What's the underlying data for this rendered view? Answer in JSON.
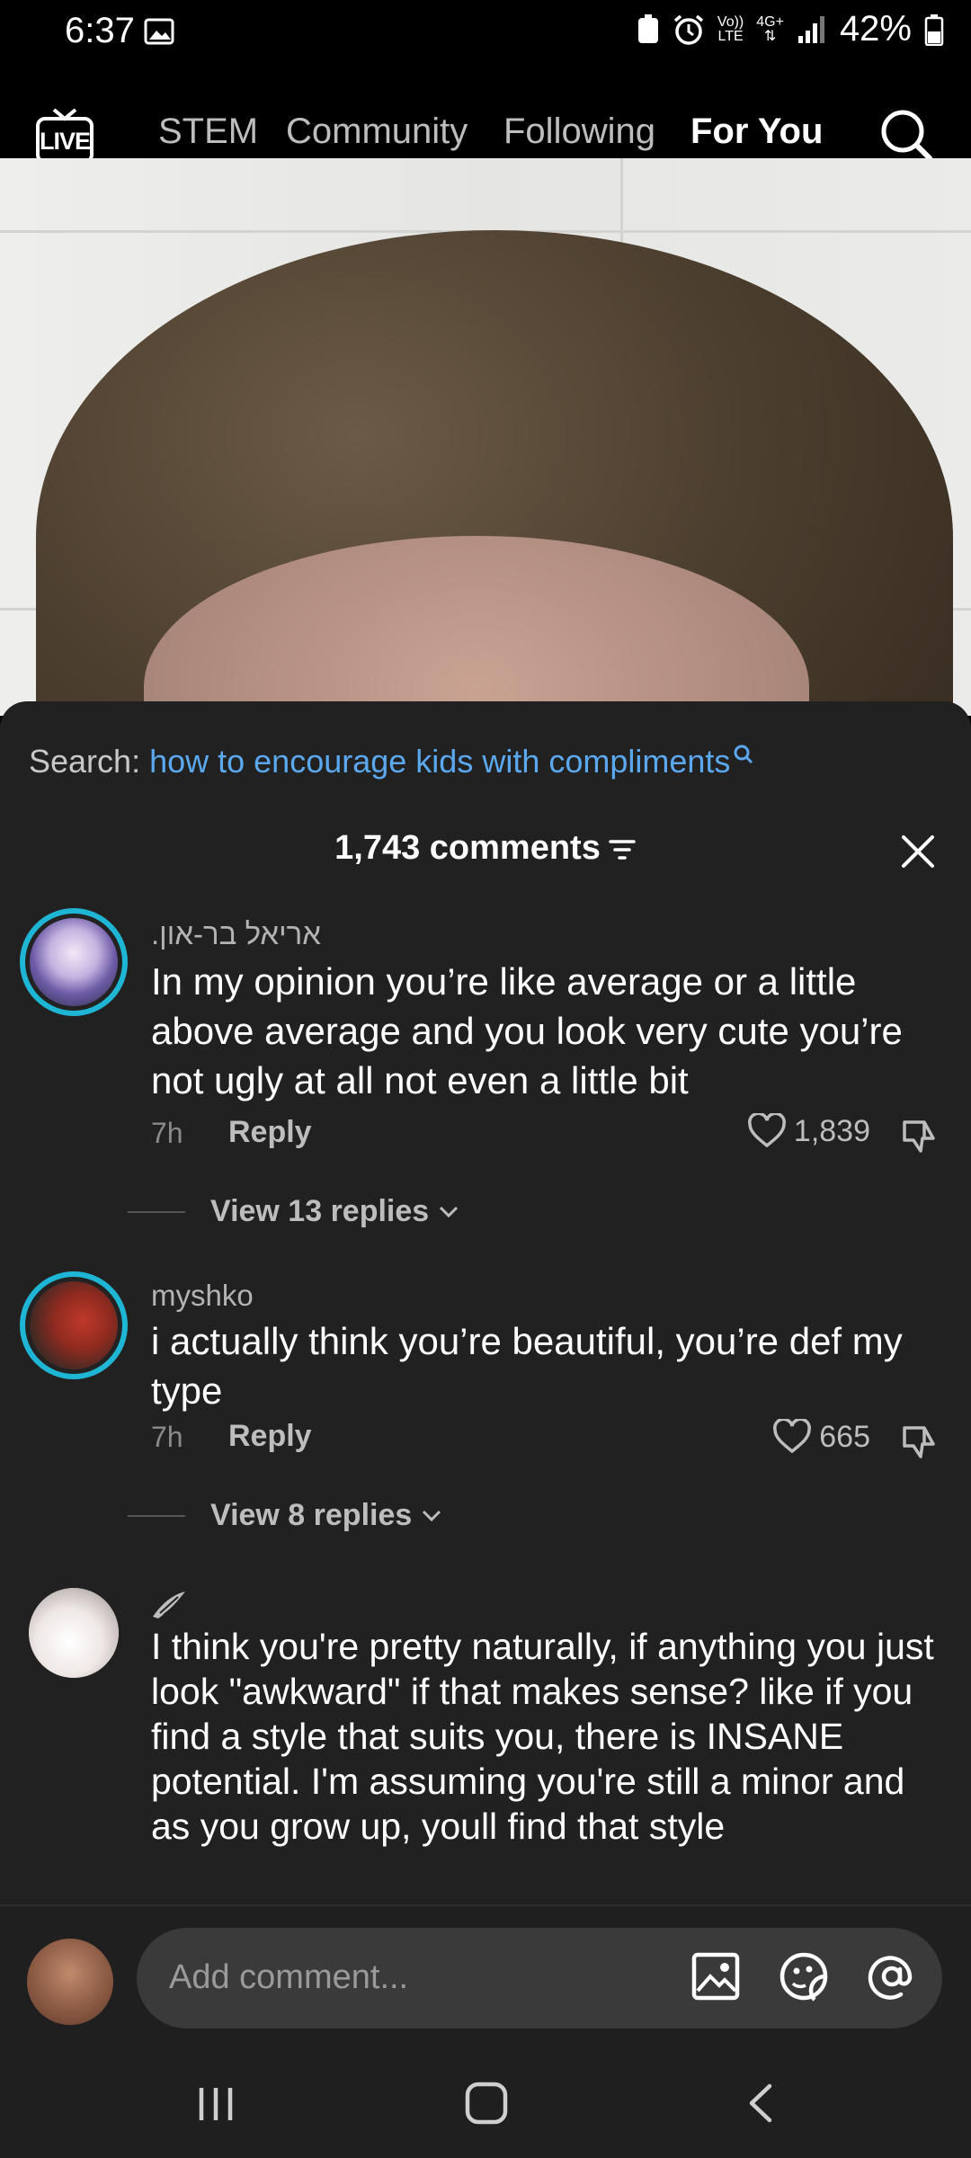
{
  "status_bar": {
    "time": "6:37",
    "network_top": "Vo))",
    "network_bottom": "LTE",
    "net_gen": "4G+",
    "battery": "42%"
  },
  "top_nav": {
    "live_label": "LIVE",
    "tabs": [
      {
        "label": "STEM",
        "active": false
      },
      {
        "label": "Community",
        "active": false
      },
      {
        "label": "Following",
        "active": false
      },
      {
        "label": "For You",
        "active": true
      }
    ]
  },
  "comments_panel": {
    "search_label": "Search:",
    "search_query": "how to encourage kids with compliments",
    "count_label": "1,743 comments",
    "comments": [
      {
        "username": ".אריאל בר-און",
        "text": "In my opinion you’re like average or a little above average and you look very cute you’re not ugly at all not even a little bit",
        "time": "7h",
        "reply_label": "Reply",
        "likes": "1,839",
        "view_replies": "View 13 replies"
      },
      {
        "username": "myshko",
        "text": "i actually think you’re beautiful, you’re def my type",
        "time": "7h",
        "reply_label": "Reply",
        "likes": "665",
        "view_replies": "View 8 replies"
      },
      {
        "username": "",
        "text": "I think you're pretty naturally, if anything you just look \"awkward\" if that makes sense? like if you find a style that suits you, there is INSANE potential. I'm assuming you're still a minor and as you grow up, youll find that style"
      }
    ]
  },
  "comment_input": {
    "placeholder": "Add comment..."
  },
  "colors": {
    "sheet_bg": "#212121",
    "accent_link": "#5ba8ef",
    "avatar_ring": "#1fb6d6"
  },
  "icons": [
    "image-icon",
    "live-icon",
    "search-icon",
    "filter-icon",
    "close-icon",
    "heart-icon",
    "dislike-icon",
    "chevron-down-icon",
    "wing-icon",
    "photo-icon",
    "sticker-icon",
    "mention-icon",
    "recents-icon",
    "home-icon",
    "back-icon"
  ]
}
